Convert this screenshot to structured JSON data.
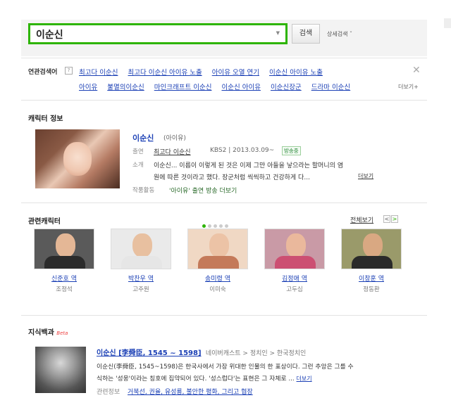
{
  "search": {
    "query": "이순신",
    "dropdown_icon": "triangle-down",
    "button_label": "검색",
    "advanced_label": "상세검색 ˇ"
  },
  "related": {
    "label": "연관검색어",
    "help": "?",
    "row1": [
      "최고다 이순신",
      "최고다 이순신 아이유 노출",
      "아이유 오열 연기",
      "이순신 아이유 노출"
    ],
    "row2": [
      "아이유",
      "불멸의이순신",
      "마인크래프트 이순신",
      "이순신 아이유",
      "이순신장군",
      "드라마 이순신"
    ],
    "more_label": "더보기+",
    "close": "✕"
  },
  "character": {
    "section_title": "캐릭터 정보",
    "name": "이순신",
    "sub": "(아이유)",
    "appearance_label": "출연",
    "appearance_show": "최고다 이순신",
    "appearance_meta": "KBS2 | 2013.03.09~",
    "status_badge": "방송중",
    "intro_label": "소개",
    "intro_line1": "이순신... 이름이 이렇게 된 것은 이제 그만 아들을 낳으라는 할머니의 염",
    "intro_line2": "원에 따른 것이라고 했다. 장군처럼 씩씩하고 건강하게 다...",
    "intro_more": "더보기",
    "works_label": "작품활동",
    "works_text": "'아이유' 출연 방송 더보기"
  },
  "related_characters": {
    "section_title": "관련캐릭터",
    "see_all": "전체보기",
    "prev": "<",
    "next": ">",
    "items": [
      {
        "role": "신준호 역",
        "actor": "조정석"
      },
      {
        "role": "박찬우 역",
        "actor": "고주원"
      },
      {
        "role": "송미령 역",
        "actor": "이미숙"
      },
      {
        "role": "김정애 역",
        "actor": "고두심"
      },
      {
        "role": "이창훈 역",
        "actor": "정동환"
      }
    ]
  },
  "encyclopedia": {
    "section_title": "지식백과",
    "beta": "Beta",
    "title": "이순신 [李舜臣, 1545 ~ 1598]",
    "meta": "네이버캐스트 > 정치인 > 한국정치인",
    "line1": "이순신(李舜臣, 1545~1598)은 한국사에서 가장 위대한 인물의 한 표상이다. 그런 추앙은 그를 수",
    "line2": "식하는 '성웅'이라는 칭호에 집약되어 있다. '성스럽다'는 표현은 그 자체로 ...",
    "more": "더보기",
    "tags_label": "관련정보",
    "tags": "거북선, 권율, 유성룡, 불안한 평화, 그리고 협장"
  },
  "colors": {
    "accent_green": "#2db400",
    "link_blue": "#1a3fb5"
  }
}
